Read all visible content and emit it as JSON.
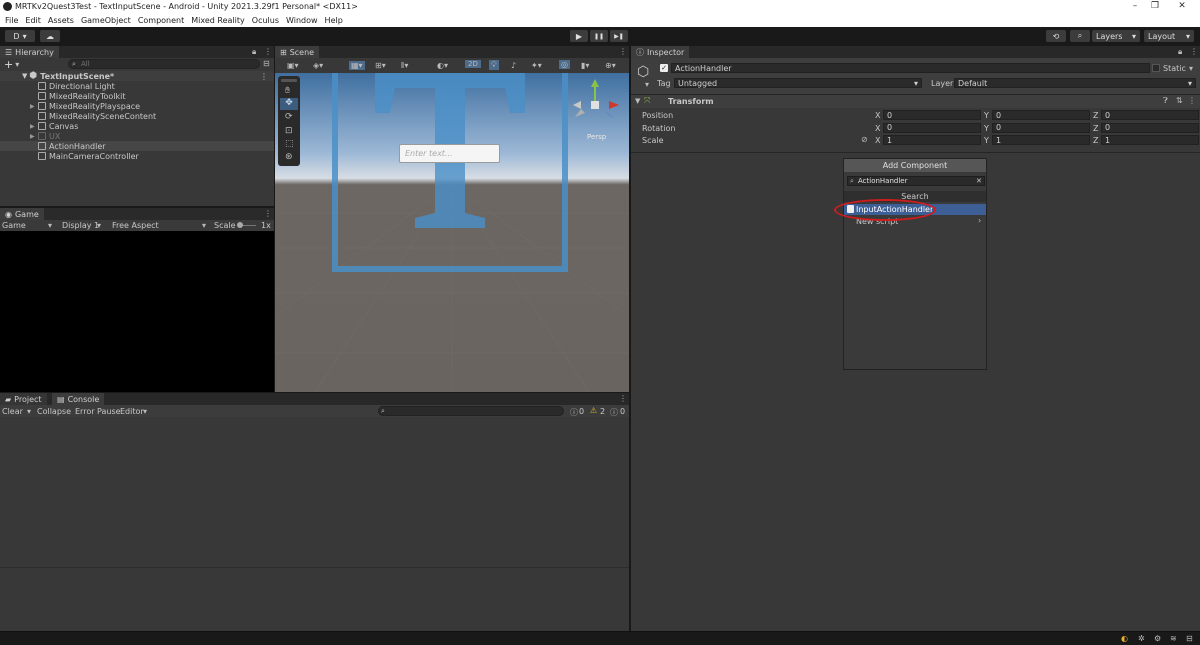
{
  "window": {
    "title": "MRTKv2Quest3Test - TextInputScene - Android - Unity 2021.3.29f1 Personal* <DX11>",
    "minimize": "–",
    "maximize": "❐",
    "close": "✕"
  },
  "menu": [
    "File",
    "Edit",
    "Assets",
    "GameObject",
    "Component",
    "Mixed Reality",
    "Oculus",
    "Window",
    "Help"
  ],
  "toolbar": {
    "account": "D",
    "play": "▶",
    "pause": "❚❚",
    "step": "▶❚",
    "layers": "Layers",
    "layout": "Layout"
  },
  "hierarchy": {
    "tab": "Hierarchy",
    "search_placeholder": "All",
    "add": "+",
    "scene": "TextInputScene*",
    "items": [
      {
        "label": "Directional Light",
        "expandable": false,
        "dim": false,
        "selected": false
      },
      {
        "label": "MixedRealityToolkit",
        "expandable": false,
        "dim": false,
        "selected": false
      },
      {
        "label": "MixedRealityPlayspace",
        "expandable": true,
        "dim": false,
        "selected": false
      },
      {
        "label": "MixedRealitySceneContent",
        "expandable": false,
        "dim": false,
        "selected": false
      },
      {
        "label": "Canvas",
        "expandable": true,
        "dim": false,
        "selected": false
      },
      {
        "label": "UX",
        "expandable": true,
        "dim": true,
        "selected": false
      },
      {
        "label": "ActionHandler",
        "expandable": false,
        "dim": false,
        "selected": true
      },
      {
        "label": "MainCameraController",
        "expandable": false,
        "dim": false,
        "selected": false
      }
    ]
  },
  "scene": {
    "tab": "Scene",
    "mode_2d": "2D",
    "input_placeholder": "Enter text...",
    "persp": "Persp"
  },
  "game": {
    "tab": "Game",
    "mode": "Game",
    "display": "Display 1",
    "aspect": "Free Aspect",
    "scale_label": "Scale",
    "scale_value": "1x"
  },
  "project_tabs": {
    "project": "Project",
    "console": "Console"
  },
  "console": {
    "clear": "Clear",
    "collapse": "Collapse",
    "error_pause": "Error Pause",
    "editor": "Editor",
    "info_count": "0",
    "warn_count": "2",
    "error_count": "0"
  },
  "inspector": {
    "tab": "Inspector",
    "object_name": "ActionHandler",
    "static_label": "Static",
    "tag_label": "Tag",
    "tag_value": "Untagged",
    "layer_label": "Layer",
    "layer_value": "Default",
    "transform": {
      "title": "Transform",
      "rows": [
        {
          "label": "Position",
          "x": "0",
          "y": "0",
          "z": "0"
        },
        {
          "label": "Rotation",
          "x": "0",
          "y": "0",
          "z": "0"
        },
        {
          "label": "Scale",
          "x": "1",
          "y": "1",
          "z": "1"
        }
      ]
    },
    "add_component": {
      "button": "Add Component",
      "search_value": "ActionHandler",
      "header": "Search",
      "result": "InputActionHandler",
      "new_script": "New script"
    }
  },
  "colors": {
    "selection": "#2c5d87",
    "highlight": "#3e5f96",
    "annotation": "#d01c1c",
    "accent_blue": "#4a90c8"
  }
}
